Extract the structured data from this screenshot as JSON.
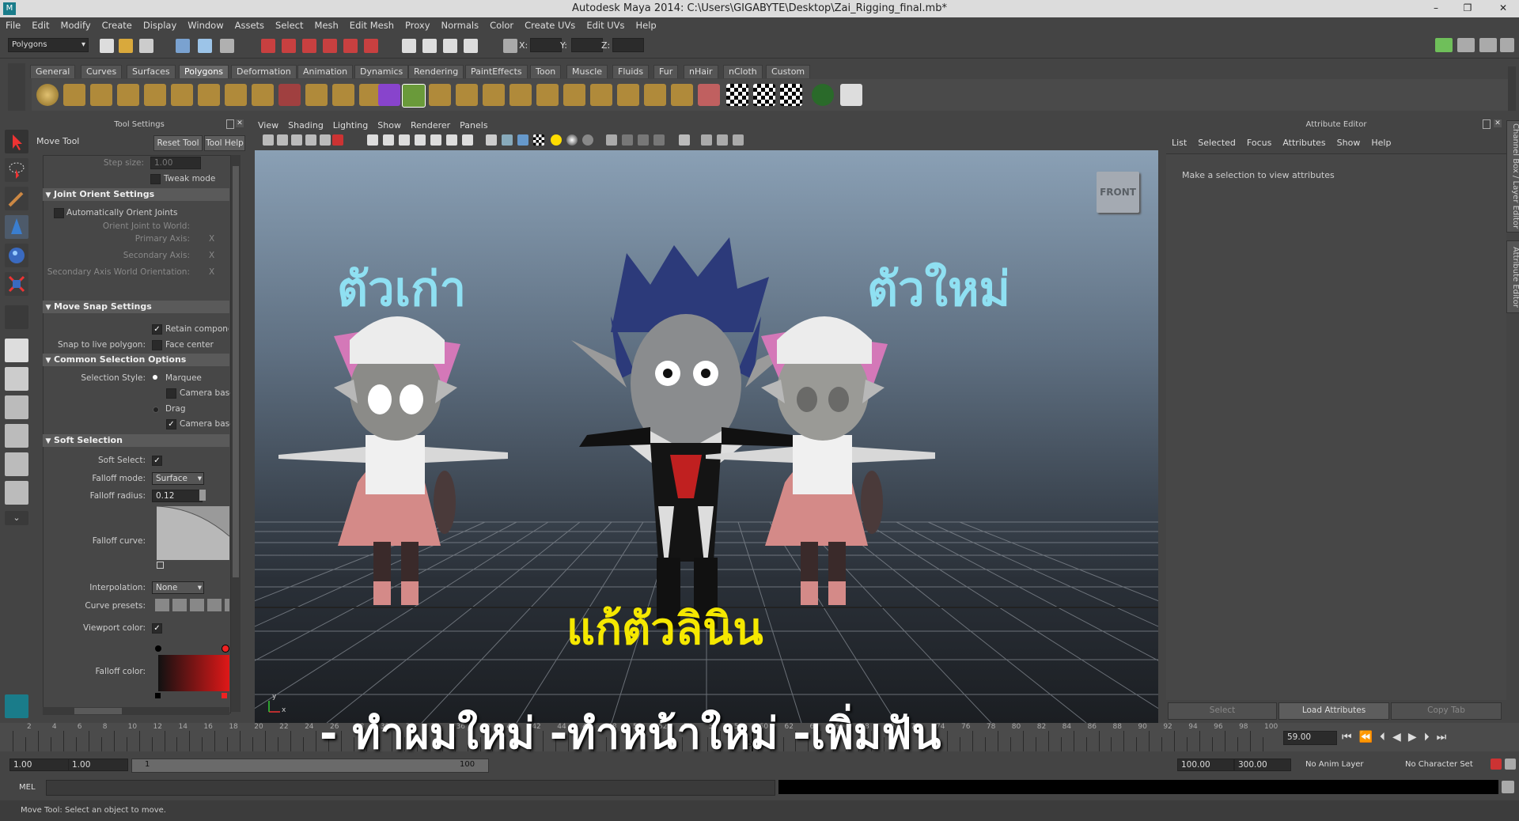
{
  "window": {
    "title": "Autodesk Maya 2014: C:\\Users\\GIGABYTE\\Desktop\\Zai_Rigging_final.mb*",
    "minimize": "–",
    "maximize": "❐",
    "close": "✕"
  },
  "menu": [
    "File",
    "Edit",
    "Modify",
    "Create",
    "Display",
    "Window",
    "Assets",
    "Select",
    "Mesh",
    "Edit Mesh",
    "Proxy",
    "Normals",
    "Color",
    "Create UVs",
    "Edit UVs",
    "Help"
  ],
  "status_line": {
    "mode": "Polygons",
    "x_label": "X:",
    "y_label": "Y:",
    "z_label": "Z:"
  },
  "shelf_tabs": [
    "General",
    "Curves",
    "Surfaces",
    "Polygons",
    "Deformation",
    "Animation",
    "Dynamics",
    "Rendering",
    "PaintEffects",
    "Toon",
    "Muscle",
    "Fluids",
    "Fur",
    "nHair",
    "nCloth",
    "Custom"
  ],
  "shelf_active": "Polygons",
  "tool_settings": {
    "header": "Tool Settings",
    "tool_name": "Move Tool",
    "reset_button": "Reset Tool",
    "help_button": "Tool Help",
    "step_size_label": "Step size:",
    "step_size_value": "1.00",
    "tweak_mode": "Tweak mode",
    "joint_orient": {
      "title": "Joint Orient Settings",
      "auto_orient": "Automatically Orient Joints",
      "orient_world": "Orient Joint to World:",
      "primary_axis": "Primary Axis:",
      "secondary_axis": "Secondary Axis:",
      "secondary_world": "Secondary Axis World Orientation:",
      "axis_value": "X"
    },
    "move_snap": {
      "title": "Move Snap Settings",
      "retain": "Retain componen",
      "snap_live_label": "Snap to live polygon:",
      "face_center": "Face center"
    },
    "common_selection": {
      "title": "Common Selection Options",
      "style_label": "Selection Style:",
      "marquee": "Marquee",
      "camera_based_1": "Camera base",
      "drag": "Drag",
      "camera_based_2": "Camera base"
    },
    "soft_selection": {
      "title": "Soft Selection",
      "soft_select_label": "Soft Select:",
      "falloff_mode_label": "Falloff mode:",
      "falloff_mode_value": "Surface",
      "falloff_radius_label": "Falloff radius:",
      "falloff_radius_value": "0.12",
      "falloff_curve_label": "Falloff curve:",
      "interpolation_label": "Interpolation:",
      "interpolation_value": "None",
      "curve_presets_label": "Curve presets:",
      "viewport_color_label": "Viewport color:",
      "falloff_color_label": "Falloff color:"
    }
  },
  "viewport": {
    "menu": [
      "View",
      "Shading",
      "Lighting",
      "Show",
      "Renderer",
      "Panels"
    ],
    "view_cube": "FRONT",
    "overlay_old": "ตัวเก่า",
    "overlay_new": "ตัวใหม่",
    "overlay_fix": "แก้ตัวลินิน",
    "overlay_list": "- ทำผมใหม่ -ทำหน้าใหม่ -เพิ่มฟัน",
    "axis_x": "x",
    "axis_y": "y"
  },
  "attribute_editor": {
    "header": "Attribute Editor",
    "menu": [
      "List",
      "Selected",
      "Focus",
      "Attributes",
      "Show",
      "Help"
    ],
    "message": "Make a selection to view attributes",
    "select_button": "Select",
    "load_button": "Load Attributes",
    "copy_tab_button": "Copy Tab"
  },
  "side_tabs": {
    "channel_box": "Channel Box / Layer Editor",
    "attribute_editor": "Attribute Editor"
  },
  "timeline": {
    "ticks": [
      "2",
      "4",
      "6",
      "8",
      "10",
      "12",
      "14",
      "16",
      "18",
      "20",
      "22",
      "24",
      "26",
      "28",
      "30",
      "32",
      "34",
      "36",
      "38",
      "40",
      "42",
      "44",
      "46",
      "48",
      "50",
      "52",
      "54",
      "56",
      "58",
      "60",
      "62",
      "64",
      "66",
      "68",
      "70",
      "72",
      "74",
      "76",
      "78",
      "80",
      "82",
      "84",
      "86",
      "88",
      "90",
      "92",
      "94",
      "96",
      "98",
      "100"
    ],
    "current_frame_marker": "59",
    "current_time": "59.00"
  },
  "range_slider": {
    "start_time": "1.00",
    "playback_start": "1.00",
    "range_start": "1",
    "range_end": "100",
    "playback_end": "100.00",
    "end_time": "300.00",
    "anim_layer": "No Anim Layer",
    "character_set": "No Character Set"
  },
  "command_line": {
    "label": "MEL"
  },
  "help_line": "Move Tool: Select an object to move."
}
